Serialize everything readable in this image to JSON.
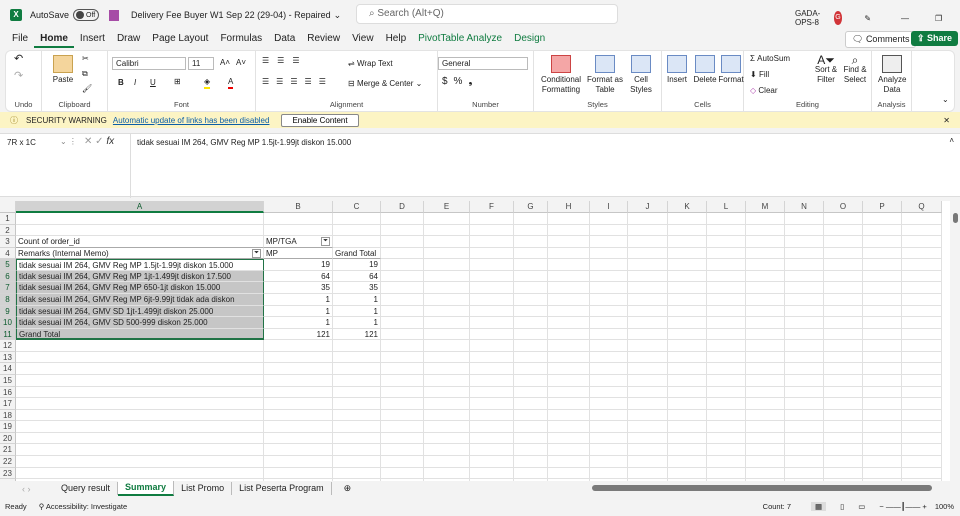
{
  "titlebar": {
    "autosave_label": "AutoSave",
    "autosave_state": "Off",
    "doc_title": "Delivery Fee Buyer W1 Sep 22 (29-04)  -  Repaired",
    "search_placeholder": "Search (Alt+Q)",
    "user": "GADA-OPS-8",
    "avatar_initial": "G"
  },
  "menu": [
    "File",
    "Home",
    "Insert",
    "Draw",
    "Page Layout",
    "Formulas",
    "Data",
    "Review",
    "View",
    "Help",
    "PivotTable Analyze",
    "Design"
  ],
  "comments_label": "Comments",
  "share_label": "Share",
  "ribbon": {
    "groups": {
      "undo": "Undo",
      "clipboard": "Clipboard",
      "font": "Font",
      "alignment": "Alignment",
      "number": "Number",
      "styles": "Styles",
      "cells": "Cells",
      "editing": "Editing",
      "analysis": "Analysis"
    },
    "paste": "Paste",
    "font_name": "Calibri",
    "font_size": "11",
    "wrap_text": "Wrap Text",
    "merge_center": "Merge & Center",
    "number_format": "General",
    "conditional_formatting": "Conditional Formatting",
    "format_as_table": "Format as Table",
    "cell_styles": "Cell Styles",
    "insert": "Insert",
    "delete": "Delete",
    "format": "Format",
    "autosum": "AutoSum",
    "fill": "Fill",
    "clear": "Clear",
    "sort_filter": "Sort & Filter",
    "find_select": "Find & Select",
    "analyze_data": "Analyze Data"
  },
  "warning": {
    "title": "SECURITY WARNING",
    "message": "Automatic update of links has been disabled",
    "button": "Enable Content"
  },
  "formula_bar": {
    "name_box": "7R x 1C",
    "formula": "tidak sesuai IM 264, GMV Reg MP 1.5jt-1.99jt diskon 15.000"
  },
  "columns": [
    "A",
    "B",
    "C",
    "D",
    "E",
    "F",
    "G",
    "H",
    "I",
    "J",
    "K",
    "L",
    "M",
    "N",
    "O",
    "P",
    "Q"
  ],
  "rows": [
    [
      "",
      "",
      ""
    ],
    [
      "",
      "",
      ""
    ],
    [
      "Count of order_id",
      "MP/TGA",
      ""
    ],
    [
      "Remarks (Internal Memo)",
      "MP",
      "Grand Total"
    ],
    [
      "tidak sesuai IM 264, GMV Reg MP 1.5jt-1.99jt diskon 15.000",
      "19",
      "19"
    ],
    [
      "tidak sesuai IM 264, GMV Reg MP 1jt-1.499jt diskon 17.500",
      "64",
      "64"
    ],
    [
      "tidak sesuai IM 264, GMV Reg MP 650-1jt diskon 15.000",
      "35",
      "35"
    ],
    [
      "tidak sesuai IM 264, GMV Reg MP 6jt-9.99jt tidak ada diskon",
      "1",
      "1"
    ],
    [
      "tidak sesuai IM 264, GMV SD 1jt-1.499jt diskon 25.000",
      "1",
      "1"
    ],
    [
      "tidak sesuai IM 264, GMV SD 500-999 diskon 25.000",
      "1",
      "1"
    ],
    [
      "Grand Total",
      "121",
      "121"
    ]
  ],
  "sheet_tabs": [
    "Query result",
    "Summary",
    "List Promo",
    "List Peserta Program"
  ],
  "status": {
    "ready": "Ready",
    "accessibility": "Accessibility: Investigate",
    "count": "Count: 7",
    "zoom": "100%"
  }
}
